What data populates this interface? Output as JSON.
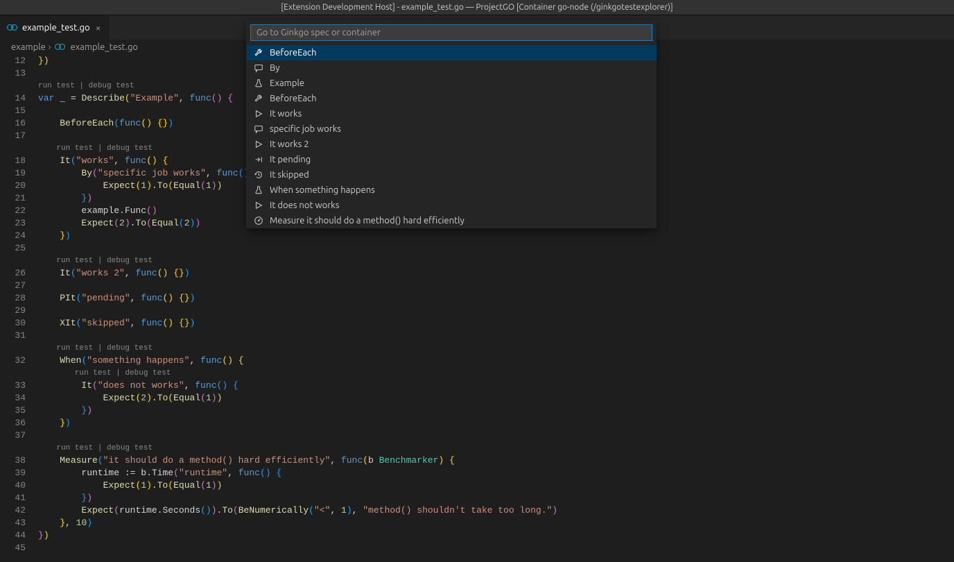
{
  "titlebar": "[Extension Development Host] - example_test.go — ProjectGO [Container go-node (/ginkgotestexplorer)]",
  "tab": {
    "label": "example_test.go"
  },
  "breadcrumb": {
    "folder": "example",
    "file": "example_test.go"
  },
  "codelens": {
    "run": "run test",
    "debug": "debug test"
  },
  "gutterLines": [
    "12",
    "13",
    "",
    "14",
    "15",
    "16",
    "17",
    "",
    "18",
    "19",
    "20",
    "21",
    "22",
    "23",
    "24",
    "25",
    "",
    "26",
    "27",
    "28",
    "29",
    "30",
    "31",
    "",
    "32",
    "",
    "33",
    "34",
    "35",
    "36",
    "37",
    "",
    "38",
    "39",
    "40",
    "41",
    "42",
    "43",
    "44",
    "45"
  ],
  "code": {
    "l12_close": "})",
    "funcKw": "func",
    "varKw": "var",
    "describe": "Describe",
    "describeArg": "\"Example\"",
    "beforeEach": "BeforeEach",
    "it": "It",
    "works": "\"works\"",
    "by": "By",
    "byArg": "\"specific job works\"",
    "expect": "Expect",
    "to": "To",
    "equal": "Equal",
    "exampleFunc": "example.Func",
    "works2": "\"works 2\"",
    "pit": "PIt",
    "pending": "\"pending\"",
    "xit": "XIt",
    "skipped": "\"skipped\"",
    "when": "When",
    "whenArg": "\"something happens\"",
    "doesNot": "\"does not works\"",
    "measure": "Measure",
    "measureArg": "\"it should do a method() hard efficiently\"",
    "bParam": "b",
    "benchmarker": "Benchmarker",
    "runtime": "runtime",
    "assign": ":=",
    "bTime": "b.Time",
    "runtimeStr": "\"runtime\"",
    "seconds": "runtime.Seconds",
    "beNum": "BeNumerically",
    "ltStr": "\"<\"",
    "msgStr": "\"method() shouldn't take too long.\"",
    "ten": "10",
    "one": "1",
    "two": "2"
  },
  "quickpick": {
    "placeholder": "Go to Ginkgo spec or container",
    "items": [
      {
        "icon": "wrench",
        "label": "BeforeEach",
        "selected": true
      },
      {
        "icon": "comment",
        "label": "By"
      },
      {
        "icon": "beaker",
        "label": "Example"
      },
      {
        "icon": "wrench",
        "label": "BeforeEach"
      },
      {
        "icon": "play",
        "label": "It works"
      },
      {
        "icon": "comment",
        "label": "specific job works"
      },
      {
        "icon": "play",
        "label": "It works 2"
      },
      {
        "icon": "skip",
        "label": "It pending"
      },
      {
        "icon": "history",
        "label": "It skipped"
      },
      {
        "icon": "beaker",
        "label": "When something happens"
      },
      {
        "icon": "play",
        "label": "It does not works"
      },
      {
        "icon": "dashboard",
        "label": "Measure it should do a method() hard efficiently"
      }
    ]
  }
}
